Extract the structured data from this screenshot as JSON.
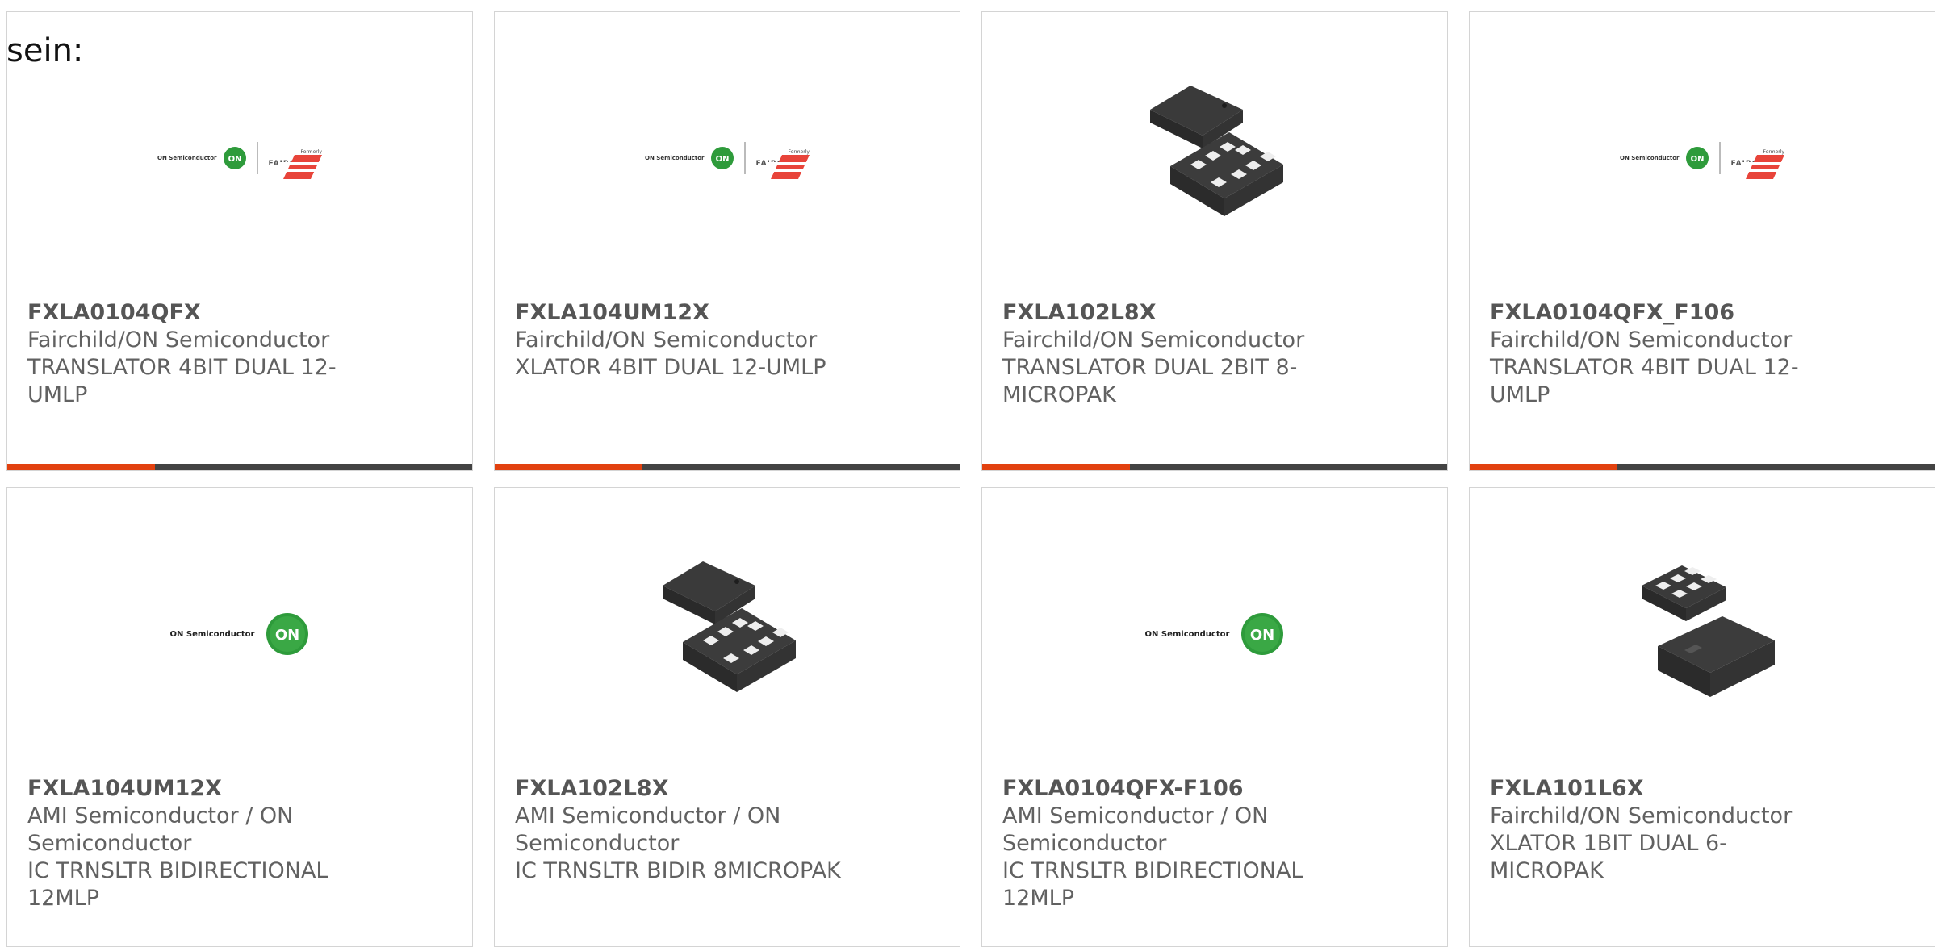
{
  "intro_text": "sein:",
  "colors": {
    "accent": "#e2410f",
    "bar": "#434343",
    "on_green": "#2e9b3b"
  },
  "cards": [
    {
      "image": "fairchild-on-logo",
      "logo_on_text": "ON Semiconductor",
      "logo_on_badge": "ON",
      "logo_formerly": "Formerly",
      "logo_fairchild": "FAIRCHILD.",
      "part": "FXLA0104QFX",
      "mfr": "Fairchild/ON Semiconductor",
      "desc": "TRANSLATOR 4BIT DUAL 12-UMLP"
    },
    {
      "image": "fairchild-on-logo",
      "logo_on_text": "ON Semiconductor",
      "logo_on_badge": "ON",
      "logo_formerly": "Formerly",
      "logo_fairchild": "FAIRCHILD.",
      "part": "FXLA104UM12X",
      "mfr": "Fairchild/ON Semiconductor",
      "desc": "XLATOR 4BIT DUAL 12-UMLP"
    },
    {
      "image": "chip-8pin",
      "part": "FXLA102L8X",
      "mfr": "Fairchild/ON Semiconductor",
      "desc": "TRANSLATOR DUAL 2BIT 8-MICROPAK"
    },
    {
      "image": "fairchild-on-logo",
      "logo_on_text": "ON Semiconductor",
      "logo_on_badge": "ON",
      "logo_formerly": "Formerly",
      "logo_fairchild": "FAIRCHILD.",
      "part": "FXLA0104QFX_F106",
      "mfr": "Fairchild/ON Semiconductor",
      "desc": "TRANSLATOR 4BIT DUAL 12-UMLP"
    },
    {
      "image": "on-logo",
      "logo_on_text": "ON Semiconductor",
      "logo_on_badge": "ON",
      "part": "FXLA104UM12X",
      "mfr": "AMI Semiconductor / ON Semiconductor",
      "desc": "IC TRNSLTR BIDIRECTIONAL 12MLP"
    },
    {
      "image": "chip-8pin",
      "part": "FXLA102L8X",
      "mfr": "AMI Semiconductor / ON Semiconductor",
      "desc": "IC TRNSLTR BIDIR 8MICROPAK"
    },
    {
      "image": "on-logo",
      "logo_on_text": "ON Semiconductor",
      "logo_on_badge": "ON",
      "part": "FXLA0104QFX-F106",
      "mfr": "AMI Semiconductor / ON Semiconductor",
      "desc": "IC TRNSLTR BIDIRECTIONAL 12MLP"
    },
    {
      "image": "chip-6pin",
      "part": "FXLA101L6X",
      "mfr": "Fairchild/ON Semiconductor",
      "desc": "XLATOR 1BIT DUAL 6-MICROPAK"
    }
  ]
}
